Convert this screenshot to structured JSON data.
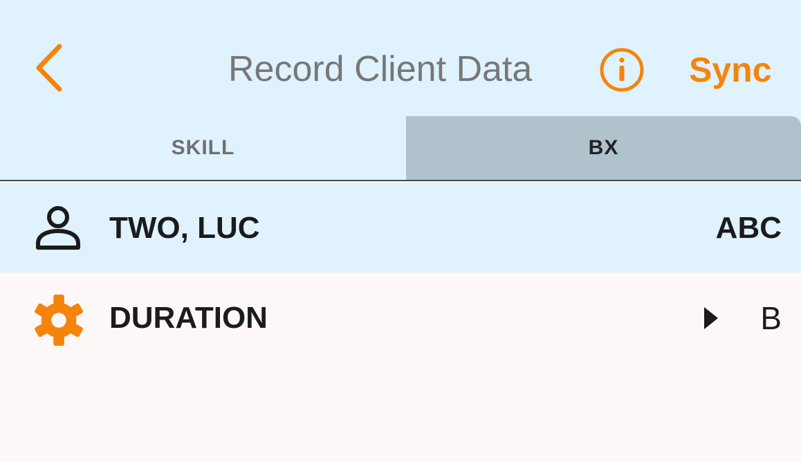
{
  "header": {
    "title": "Record Client Data",
    "back_icon": "chevron-left-icon",
    "info_icon": "info-circle-icon",
    "sync_label": "Sync"
  },
  "tabs": [
    {
      "label": "SKILL",
      "selected": false
    },
    {
      "label": "BX",
      "selected": true
    }
  ],
  "client": {
    "icon": "person-icon",
    "name": "TWO, LUC",
    "code": "ABC"
  },
  "behavior": {
    "icon": "gear-icon",
    "label": "DURATION",
    "indicator_icon": "play-triangle-icon",
    "value": "B"
  },
  "colors": {
    "accent": "#f5840c",
    "header_bg": "#dff2fd",
    "tab_selected_bg": "#b0c2cc",
    "page_bg": "#fdf8f7"
  }
}
